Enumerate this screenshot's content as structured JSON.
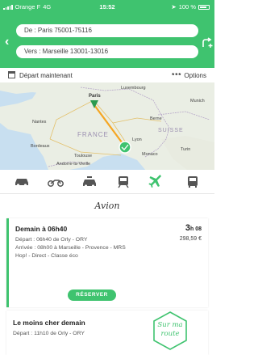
{
  "status": {
    "carrier": "Orange F",
    "network": "4G",
    "time": "15:52",
    "battery": "100 %"
  },
  "search": {
    "from": "De : Paris 75001-75116",
    "to": "Vers : Marseille 13001-13016"
  },
  "departure": {
    "label": "Départ maintenant",
    "options_label": "Options",
    "options_dots": "***"
  },
  "map": {
    "labels": {
      "luxembourg": "Luxembourg",
      "paris": "Paris",
      "france": "FRANCE",
      "suisse": "SUISSE",
      "nantes": "Nantes",
      "lyon": "Lyon",
      "bordeaux": "Bordeaux",
      "toulouse": "Toulouse",
      "monaco": "Monaco",
      "andorre": "Andorre-la-Vieille",
      "munich": "Munich",
      "turin": "Turin",
      "berne": "Berne"
    }
  },
  "tabs": [
    {
      "icon": "car-icon"
    },
    {
      "icon": "motorbike-icon"
    },
    {
      "icon": "taxi-icon"
    },
    {
      "icon": "train-icon"
    },
    {
      "icon": "plane-icon",
      "active": true
    },
    {
      "icon": "bus-icon"
    }
  ],
  "mode_title": "Avion",
  "results": [
    {
      "title": "Demain à 06h40",
      "duration_h": "3",
      "duration_rest": "h 08",
      "price": "298,59 €",
      "lines": [
        "Départ : 06h40 de Orly - ORY",
        "Arrivée : 08h00 à Marseille - Provence - MRS",
        "Hop! - Direct - Classe éco"
      ],
      "book_label": "RÉSERVER"
    },
    {
      "title": "Le moins cher demain",
      "lines": [
        "Départ : 11h10 de Orly - ORY"
      ]
    }
  ],
  "badge": {
    "line1": "Sur ma",
    "line2": "route"
  },
  "colors": {
    "brand_green": "#3fc36f",
    "route_orange": "#f5a623"
  }
}
